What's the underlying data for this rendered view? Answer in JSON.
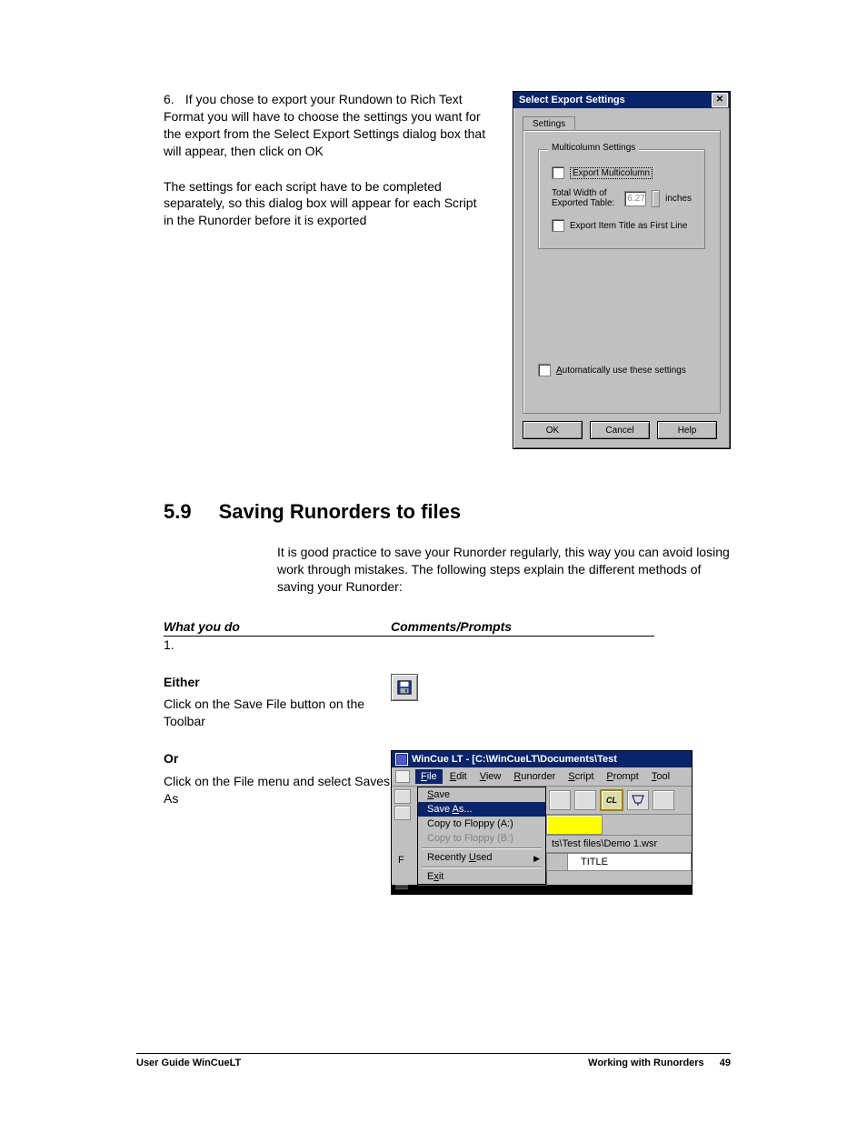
{
  "step6": {
    "num": "6.",
    "text": "If you chose to export your Rundown to Rich Text Format you will have to choose the settings you want for the export from the Select Export Settings dialog box that will appear, then click on OK",
    "followup": "The settings for each script have to be completed separately, so this dialog box will appear for each Script in the Runorder before it is exported"
  },
  "export_dialog": {
    "title": "Select Export Settings",
    "tab": "Settings",
    "group": "Multicolumn Settings",
    "chk_multicolumn": "Export Multicolumn",
    "width_label": "Total Width of Exported Table:",
    "width_value": "6.27",
    "width_unit": "inches",
    "chk_firstline": "Export Item Title as First Line",
    "chk_auto": "Automatically use these settings",
    "btn_ok": "OK",
    "btn_cancel": "Cancel",
    "btn_help": "Help"
  },
  "section": {
    "num": "5.9",
    "title": "Saving Runorders to files",
    "para": "It is good practice to save your Runorder regularly, this way you can avoid losing work through mistakes. The following steps explain the different methods of saving your Runorder:",
    "col_a": "What you do",
    "col_b": "Comments/Prompts"
  },
  "steps": {
    "s1_num": "1.",
    "either": "Either",
    "either_text": "Click on the Save File button on the Toolbar",
    "or": "Or",
    "or_text": "Click on the File menu and select Saves As"
  },
  "wincue": {
    "title": "WinCue LT - [C:\\WinCueLT\\Documents\\Test",
    "menus": [
      "File",
      "Edit",
      "View",
      "Runorder",
      "Script",
      "Prompt",
      "Tool"
    ],
    "file_items": {
      "save": "Save",
      "saveas": "Save As...",
      "copyA": "Copy to Floppy (A:)",
      "copyB": "Copy to Floppy (B:)",
      "recent": "Recently Used",
      "exit": "Exit"
    },
    "toolbar_cl": "CL",
    "path": "ts\\Test files\\Demo 1.wsr",
    "title_cell": "TITLE"
  },
  "footer": {
    "left": "User Guide WinCueLT",
    "right": "Working with Runorders",
    "page": "49"
  }
}
